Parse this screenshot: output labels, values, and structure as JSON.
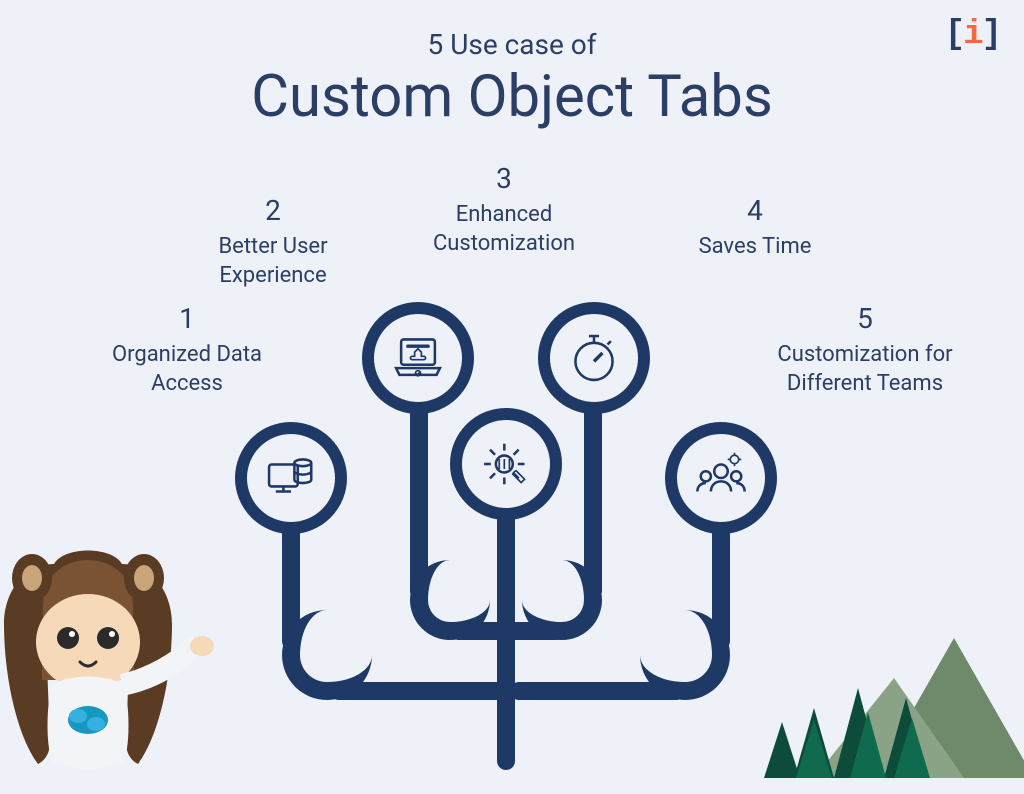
{
  "header": {
    "subtitle": "5 Use case of",
    "title": "Custom Object Tabs"
  },
  "items": [
    {
      "num": "1",
      "label": "Organized Data Access",
      "icon": "database-monitor-icon"
    },
    {
      "num": "2",
      "label": "Better User Experience",
      "icon": "laptop-thumbsup-icon"
    },
    {
      "num": "3",
      "label": "Enhanced Customization",
      "icon": "gear-wrench-icon"
    },
    {
      "num": "4",
      "label": "Saves Time",
      "icon": "stopwatch-icon"
    },
    {
      "num": "5",
      "label": "Customization for Different Teams",
      "icon": "team-gear-icon"
    }
  ],
  "colors": {
    "bg": "#eef1f8",
    "brand": "#1f3966",
    "text": "#2a3e66"
  }
}
